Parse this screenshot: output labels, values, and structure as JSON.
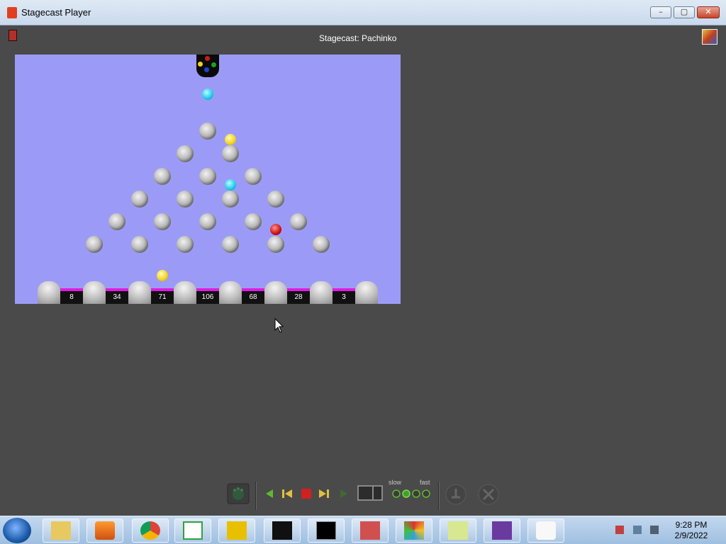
{
  "window": {
    "title": "Stagecast Player",
    "minimize": "–",
    "maximize": "▢",
    "close": "✕"
  },
  "stage": {
    "title": "Stagecast: Pachinko",
    "bins": [
      "8",
      "34",
      "71",
      "106",
      "68",
      "28",
      "3"
    ],
    "colors": {
      "background": "#9b9bf7",
      "bin_rail": "#e01ce0"
    }
  },
  "controls": {
    "slow_label": "slow",
    "fast_label": "fast",
    "speed_setting": 2,
    "speed_levels": 4
  },
  "taskbar": {
    "apps": [
      "start-orb",
      "file-explorer-icon",
      "media-player-icon",
      "chrome-icon",
      "bunny-app-icon",
      "x-app-icon",
      "oscilloscope-icon",
      "terminal-icon",
      "grid-app-icon",
      "puzzle-app-icon",
      "sticky-notes-icon",
      "help-book-icon",
      "java-icon"
    ],
    "clock_time": "9:28 PM",
    "clock_date": "2/9/2022"
  }
}
